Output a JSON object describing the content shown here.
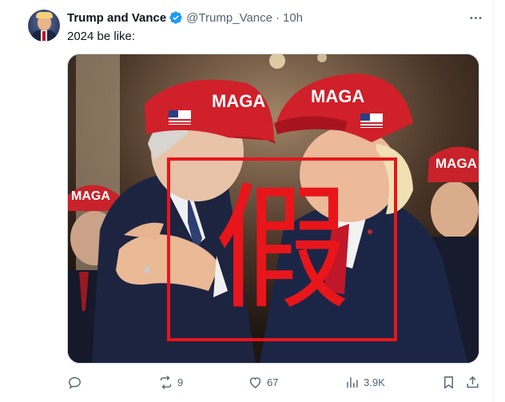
{
  "tweet": {
    "display_name": "Trump and Vance",
    "handle": "@Trump_Vance",
    "separator": "·",
    "time": "10h",
    "text": "2024 be like:",
    "verified": true,
    "more_icon": "more-horizontal-icon"
  },
  "media": {
    "overlay_character": "假",
    "cap_text_left": "MAGA",
    "cap_text_right": "MAGA",
    "cap_text_bg_right": "MAGA",
    "cap_text_bg_left": "MAGA",
    "overlay_color": "#e8151b",
    "cap_color": "#d0202a"
  },
  "actions": {
    "reply": {
      "icon": "reply-icon",
      "count": ""
    },
    "retweet": {
      "icon": "retweet-icon",
      "count": "9"
    },
    "like": {
      "icon": "heart-icon",
      "count": "67"
    },
    "views": {
      "icon": "views-chart-icon",
      "count": "3.9K"
    },
    "bookmark": {
      "icon": "bookmark-icon"
    },
    "share": {
      "icon": "share-icon"
    }
  }
}
